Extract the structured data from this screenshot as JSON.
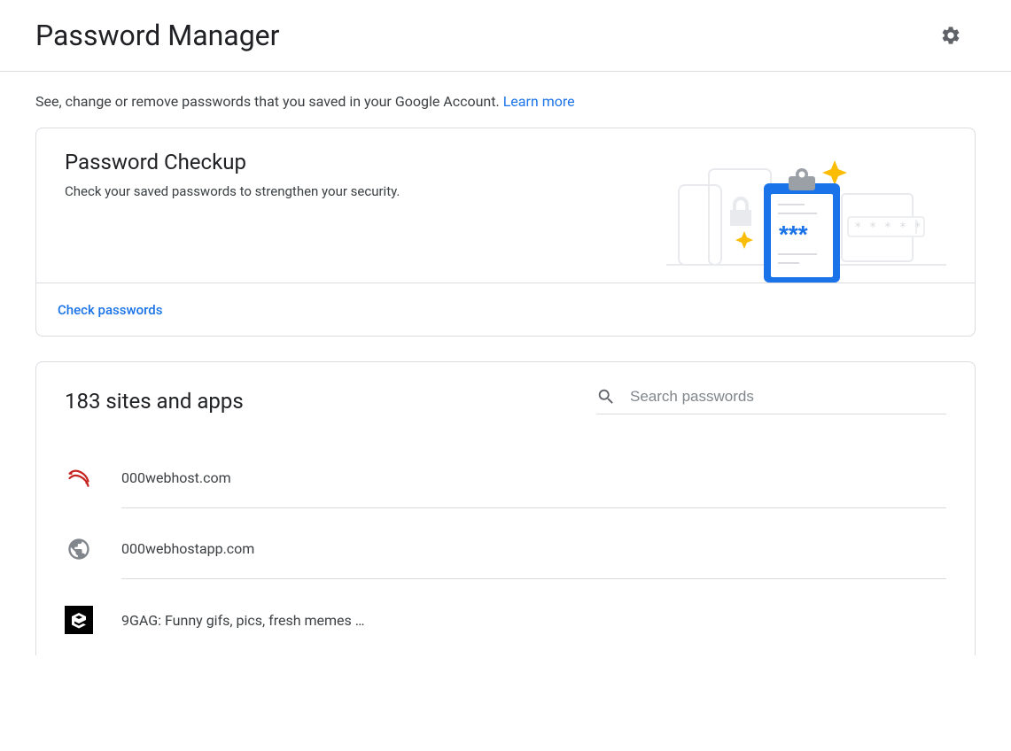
{
  "header": {
    "title": "Password Manager"
  },
  "intro": {
    "text": "See, change or remove passwords that you saved in your Google Account. ",
    "learn_more": "Learn more"
  },
  "checkup": {
    "title": "Password Checkup",
    "subtitle": "Check your saved passwords to strengthen your security.",
    "action": "Check passwords"
  },
  "sites": {
    "heading": "183 sites and apps",
    "search_placeholder": "Search passwords",
    "items": [
      {
        "name": "000webhost.com",
        "icon": "webhost"
      },
      {
        "name": "000webhostapp.com",
        "icon": "globe"
      },
      {
        "name": "9GAG: Funny gifs, pics, fresh memes …",
        "icon": "9gag"
      }
    ]
  }
}
